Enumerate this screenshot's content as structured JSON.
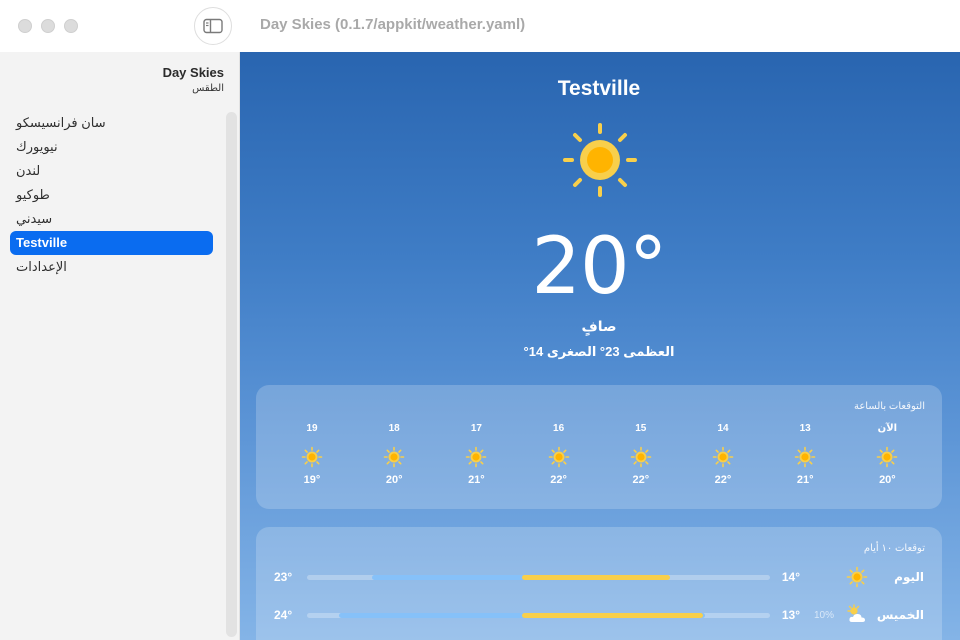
{
  "window": {
    "title": "Day Skies (0.1.7/appkit/weather.yaml)"
  },
  "sidebar": {
    "title": "Day Skies",
    "subtitle": "الطقس",
    "items": [
      {
        "label": "سان فرانسيسكو",
        "selected": false
      },
      {
        "label": "نيويورك",
        "selected": false
      },
      {
        "label": "لندن",
        "selected": false
      },
      {
        "label": "طوكيو",
        "selected": false
      },
      {
        "label": "سيدني",
        "selected": false
      },
      {
        "label": "Testville",
        "selected": true
      },
      {
        "label": "الإعدادات",
        "selected": false
      }
    ]
  },
  "current": {
    "city": "Testville",
    "icon": "sun-icon",
    "temperature": "20°",
    "condition": "صافٍ",
    "high_low": "العظمى 23° الصغرى 14°"
  },
  "hourly": {
    "title": "التوقعات بالساعة",
    "items": [
      {
        "label": "الآن",
        "icon": "sun-icon",
        "temp": "20°"
      },
      {
        "label": "13",
        "icon": "sun-icon",
        "temp": "21°"
      },
      {
        "label": "14",
        "icon": "sun-icon",
        "temp": "22°"
      },
      {
        "label": "15",
        "icon": "sun-icon",
        "temp": "22°"
      },
      {
        "label": "16",
        "icon": "sun-icon",
        "temp": "22°"
      },
      {
        "label": "17",
        "icon": "sun-icon",
        "temp": "21°"
      },
      {
        "label": "18",
        "icon": "sun-icon",
        "temp": "20°"
      },
      {
        "label": "19",
        "icon": "sun-icon",
        "temp": "19°"
      }
    ]
  },
  "daily": {
    "title": "توقعات ١٠ أيام",
    "days": [
      {
        "name": "اليوم",
        "icon": "sun-icon",
        "pop": "",
        "low": "14°",
        "high": "23°",
        "range_start": 0.14,
        "range_end": 0.78,
        "fill_start": 0.465,
        "fill_end": 0.785
      },
      {
        "name": "الخميس",
        "icon": "partly-cloudy-icon",
        "pop": "10%",
        "low": "13°",
        "high": "24°",
        "range_start": 0.07,
        "range_end": 0.86,
        "fill_start": 0.465,
        "fill_end": 0.855
      }
    ]
  },
  "colors": {
    "accent": "#0a6cf0",
    "sun": "#f8cf4b",
    "sun_core": "#ffb400",
    "bar_blue": "#86c1f9"
  }
}
